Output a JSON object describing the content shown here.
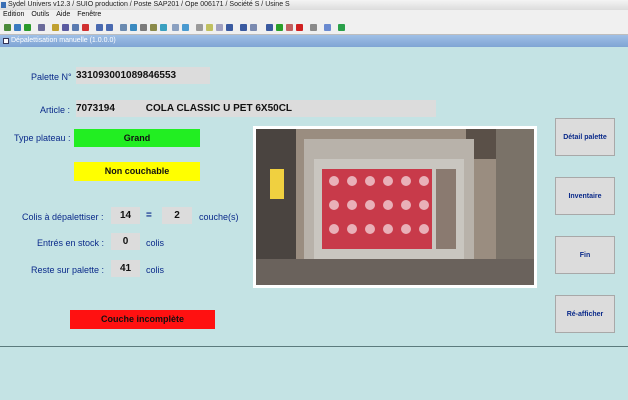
{
  "window": {
    "title": "Sydel Univers v12.3 / SUIO production / Poste SAP201 / Ope 006171 / Société S / Usine S",
    "menu": [
      "Edition",
      "Outils",
      "Aide",
      "Fenêtre"
    ],
    "subwindow_title": "Dépalettisation manuelle (1.0.0.0)"
  },
  "form": {
    "palette_label": "Palette N°",
    "palette_value": "331093001089846553",
    "article_label": "Article :",
    "article_code": "7073194",
    "article_name": "COLA CLASSIC U PET 6X50CL",
    "type_plateau_label": "Type plateau :",
    "type_plateau_value": "Grand",
    "couchable_value": "Non couchable",
    "colis_label": "Colis à dépalettiser :",
    "colis_value": "14",
    "equals": "=",
    "couches_value": "2",
    "couches_unit": "couche(s)",
    "entres_label": "Entrés en stock :",
    "entres_value": "0",
    "entres_unit": "colis",
    "reste_label": "Reste sur palette :",
    "reste_value": "41",
    "reste_unit": "colis",
    "status_value": "Couche incomplète"
  },
  "buttons": {
    "detail": "Détail palette",
    "inventaire": "Inventaire",
    "fin": "Fin",
    "reafficher": "Ré-afficher"
  },
  "colors": {
    "background": "#c4e3e4",
    "green": "#22ee22",
    "yellow": "#ffff00",
    "red": "#ff1111",
    "label_blue": "#0a2a8a"
  }
}
